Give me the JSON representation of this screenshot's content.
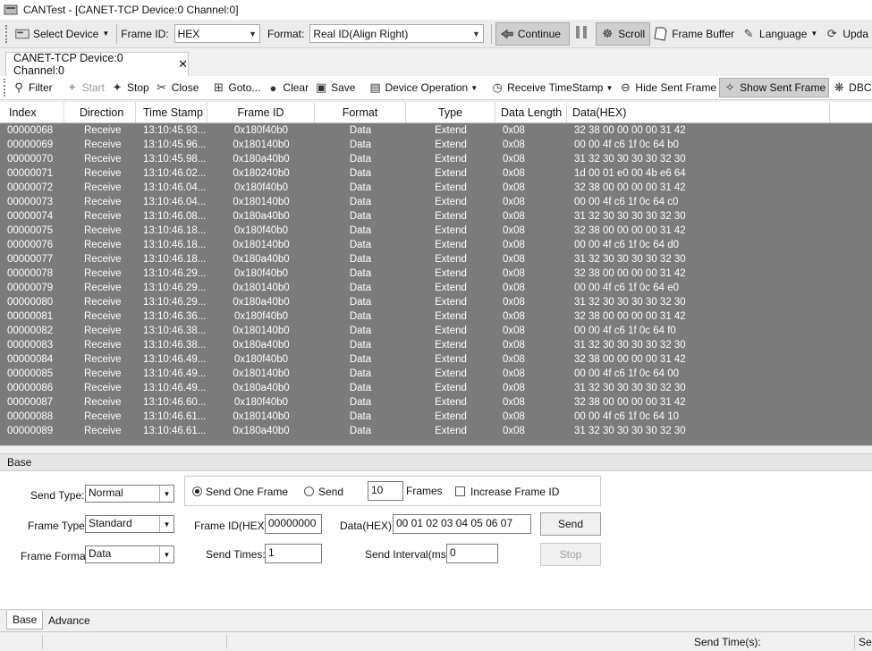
{
  "window": {
    "title": "CANTest  - [CANET-TCP Device:0 Channel:0]"
  },
  "toolbar1": {
    "select_device": "Select Device",
    "frame_id_label": "Frame ID:",
    "frame_id_value": "HEX",
    "format_label": "Format:",
    "format_value": "Real ID(Align Right)",
    "continue": "Continue",
    "scroll": "Scroll",
    "frame_buffer": "Frame Buffer",
    "language": "Language",
    "update": "Upda"
  },
  "tab": {
    "label": "CANET-TCP Device:0 Channel:0",
    "close": "✕"
  },
  "toolbar2": {
    "filter": "Filter",
    "start": "Start",
    "stop": "Stop",
    "close": "Close",
    "goto": "Goto...",
    "clear": "Clear",
    "save": "Save",
    "device_operation": "Device Operation",
    "receive_timestamp": "Receive TimeStamp",
    "hide_sent": "Hide Sent Frame",
    "show_sent": "Show Sent Frame",
    "dbc": "DBC"
  },
  "grid": {
    "columns": [
      "Index",
      "Direction",
      "Time Stamp",
      "Frame ID",
      "Format",
      "Type",
      "Data Length",
      "Data(HEX)"
    ],
    "rows": [
      [
        "00000068",
        "Receive",
        "13:10:45.93...",
        "0x180f40b0",
        "Data",
        "Extend",
        "0x08",
        "32 38 00 00 00 00 31 42"
      ],
      [
        "00000069",
        "Receive",
        "13:10:45.96...",
        "0x180140b0",
        "Data",
        "Extend",
        "0x08",
        "00 00 4f c6 1f 0c 64 b0"
      ],
      [
        "00000070",
        "Receive",
        "13:10:45.98...",
        "0x180a40b0",
        "Data",
        "Extend",
        "0x08",
        "31 32 30 30 30 30 32 30"
      ],
      [
        "00000071",
        "Receive",
        "13:10:46.02...",
        "0x180240b0",
        "Data",
        "Extend",
        "0x08",
        "1d 00 01 e0 00 4b e6 64"
      ],
      [
        "00000072",
        "Receive",
        "13:10:46.04...",
        "0x180f40b0",
        "Data",
        "Extend",
        "0x08",
        "32 38 00 00 00 00 31 42"
      ],
      [
        "00000073",
        "Receive",
        "13:10:46.04...",
        "0x180140b0",
        "Data",
        "Extend",
        "0x08",
        "00 00 4f c6 1f 0c 64 c0"
      ],
      [
        "00000074",
        "Receive",
        "13:10:46.08...",
        "0x180a40b0",
        "Data",
        "Extend",
        "0x08",
        "31 32 30 30 30 30 32 30"
      ],
      [
        "00000075",
        "Receive",
        "13:10:46.18...",
        "0x180f40b0",
        "Data",
        "Extend",
        "0x08",
        "32 38 00 00 00 00 31 42"
      ],
      [
        "00000076",
        "Receive",
        "13:10:46.18...",
        "0x180140b0",
        "Data",
        "Extend",
        "0x08",
        "00 00 4f c6 1f 0c 64 d0"
      ],
      [
        "00000077",
        "Receive",
        "13:10:46.18...",
        "0x180a40b0",
        "Data",
        "Extend",
        "0x08",
        "31 32 30 30 30 30 32 30"
      ],
      [
        "00000078",
        "Receive",
        "13:10:46.29...",
        "0x180f40b0",
        "Data",
        "Extend",
        "0x08",
        "32 38 00 00 00 00 31 42"
      ],
      [
        "00000079",
        "Receive",
        "13:10:46.29...",
        "0x180140b0",
        "Data",
        "Extend",
        "0x08",
        "00 00 4f c6 1f 0c 64 e0"
      ],
      [
        "00000080",
        "Receive",
        "13:10:46.29...",
        "0x180a40b0",
        "Data",
        "Extend",
        "0x08",
        "31 32 30 30 30 30 32 30"
      ],
      [
        "00000081",
        "Receive",
        "13:10:46.36...",
        "0x180f40b0",
        "Data",
        "Extend",
        "0x08",
        "32 38 00 00 00 00 31 42"
      ],
      [
        "00000082",
        "Receive",
        "13:10:46.38...",
        "0x180140b0",
        "Data",
        "Extend",
        "0x08",
        "00 00 4f c6 1f 0c 64 f0"
      ],
      [
        "00000083",
        "Receive",
        "13:10:46.38...",
        "0x180a40b0",
        "Data",
        "Extend",
        "0x08",
        "31 32 30 30 30 30 32 30"
      ],
      [
        "00000084",
        "Receive",
        "13:10:46.49...",
        "0x180f40b0",
        "Data",
        "Extend",
        "0x08",
        "32 38 00 00 00 00 31 42"
      ],
      [
        "00000085",
        "Receive",
        "13:10:46.49...",
        "0x180140b0",
        "Data",
        "Extend",
        "0x08",
        "00 00 4f c6 1f 0c 64 00"
      ],
      [
        "00000086",
        "Receive",
        "13:10:46.49...",
        "0x180a40b0",
        "Data",
        "Extend",
        "0x08",
        "31 32 30 30 30 30 32 30"
      ],
      [
        "00000087",
        "Receive",
        "13:10:46.60...",
        "0x180f40b0",
        "Data",
        "Extend",
        "0x08",
        "32 38 00 00 00 00 31 42"
      ],
      [
        "00000088",
        "Receive",
        "13:10:46.61...",
        "0x180140b0",
        "Data",
        "Extend",
        "0x08",
        "00 00 4f c6 1f 0c 64 10"
      ],
      [
        "00000089",
        "Receive",
        "13:10:46.61...",
        "0x180a40b0",
        "Data",
        "Extend",
        "0x08",
        "31 32 30 30 30 30 32 30"
      ]
    ]
  },
  "panel": {
    "title": "Base",
    "send_type_label": "Send Type:",
    "send_type_value": "Normal",
    "send_one_frame": "Send One Frame",
    "send": "Send",
    "frames_count": "10",
    "frames_label": "Frames",
    "increase_frame_id": "Increase Frame ID",
    "frame_type_label": "Frame Type:",
    "frame_type_value": "Standard",
    "frame_id_hex_label": "Frame ID(HEX):",
    "frame_id_hex_value": "00000000",
    "data_hex_label": "Data(HEX):",
    "data_hex_value": "00 01 02 03 04 05 06 07",
    "send_button": "Send",
    "frame_format_label": "Frame Format:",
    "frame_format_value": "Data",
    "send_times_label": "Send Times:",
    "send_times_value": "1",
    "send_interval_label": "Send Interval(ms):",
    "send_interval_value": "0",
    "stop_button": "Stop"
  },
  "bottom_tabs": {
    "base": "Base",
    "advance": "Advance"
  },
  "status": {
    "send_time_label": "Send Time(s):",
    "truncated": "Se"
  },
  "colors": {
    "grid_background": "#7b7b7b",
    "grid_text": "#ffffff"
  }
}
